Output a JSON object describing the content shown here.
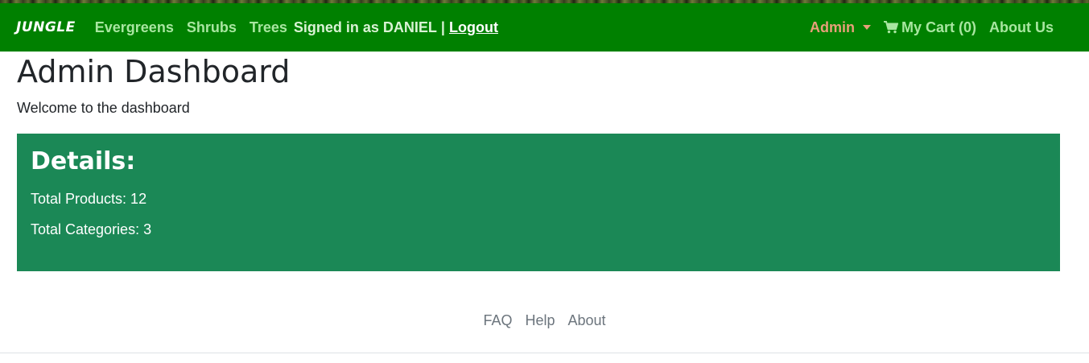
{
  "navbar": {
    "brand": "JUNGLE",
    "links": [
      "Evergreens",
      "Shrubs",
      "Trees"
    ],
    "signed_in_text": "Signed in as DANIEL",
    "separator": "|",
    "logout_label": "Logout",
    "admin_label": "Admin",
    "cart_label": "My Cart (0)",
    "about_label": "About Us",
    "colors": {
      "background": "#008000",
      "link": "#a8e6a0",
      "admin": "#e8a07a"
    }
  },
  "main": {
    "title": "Admin Dashboard",
    "welcome": "Welcome to the dashboard",
    "details": {
      "heading": "Details:",
      "total_products": "Total Products: 12",
      "total_categories": "Total Categories: 3",
      "background": "#1b8856"
    }
  },
  "footer": {
    "links": [
      "FAQ",
      "Help",
      "About"
    ]
  },
  "icons": {
    "cart": "shopping-cart-icon",
    "caret": "caret-down-icon"
  }
}
